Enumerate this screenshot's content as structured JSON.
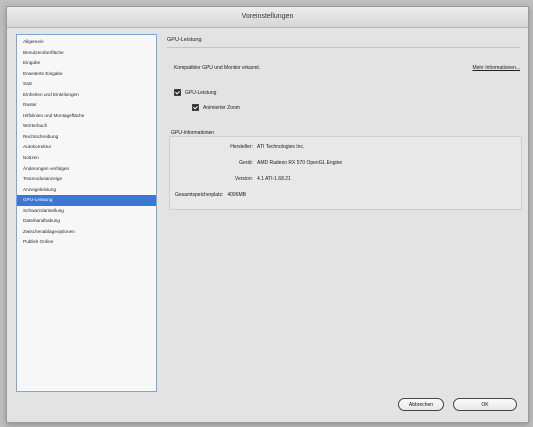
{
  "window": {
    "title": "Voreinstellungen"
  },
  "sidebar": {
    "items": [
      {
        "label": "Allgemein"
      },
      {
        "label": "Benutzeroberfläche"
      },
      {
        "label": "Eingabe"
      },
      {
        "label": "Erweiterte Eingabe"
      },
      {
        "label": "Satz"
      },
      {
        "label": "Einheiten und Einteilungen"
      },
      {
        "label": "Raster"
      },
      {
        "label": "Hilfslinien und Montagefläche"
      },
      {
        "label": "Wörterbuch"
      },
      {
        "label": "Rechtschreibung"
      },
      {
        "label": "Autokorrektur"
      },
      {
        "label": "Notizen"
      },
      {
        "label": "Änderungen verfolgen"
      },
      {
        "label": "Textmodusanzeige"
      },
      {
        "label": "Anzeigeleistung"
      },
      {
        "label": "GPU-Leistung"
      },
      {
        "label": "Schwarzdarstellung"
      },
      {
        "label": "Dateihandhabung"
      },
      {
        "label": "Zwischenablageoptionen"
      },
      {
        "label": "Publish Online"
      }
    ],
    "selected_index": 15
  },
  "main": {
    "section_title": "GPU-Leistung",
    "compat_message": "Kompatibler GPU und Monitor erkannt.",
    "more_info": "Mehr Informationen...",
    "gpu_checkbox": {
      "label": "GPU-Leistung",
      "checked": true
    },
    "zoom_checkbox": {
      "label": "Animierter Zoom",
      "checked": true
    },
    "gpu_info": {
      "title": "GPU-Informationen",
      "rows": [
        {
          "label": "Hersteller:",
          "value": "ATI Technologies Inc."
        },
        {
          "label": "Gerät:",
          "value": "AMD Radeon RX 570 OpenGL Engine"
        },
        {
          "label": "Version:",
          "value": "4.1 ATI-1.68.21"
        },
        {
          "label": "Gesamtspeicherplatz:",
          "value": "4096MB"
        }
      ]
    }
  },
  "footer": {
    "cancel_label": "Abbrechen",
    "ok_label": "OK"
  },
  "colors": {
    "selection": "#3a78d4",
    "sidebar_border": "#7aa7dc"
  }
}
